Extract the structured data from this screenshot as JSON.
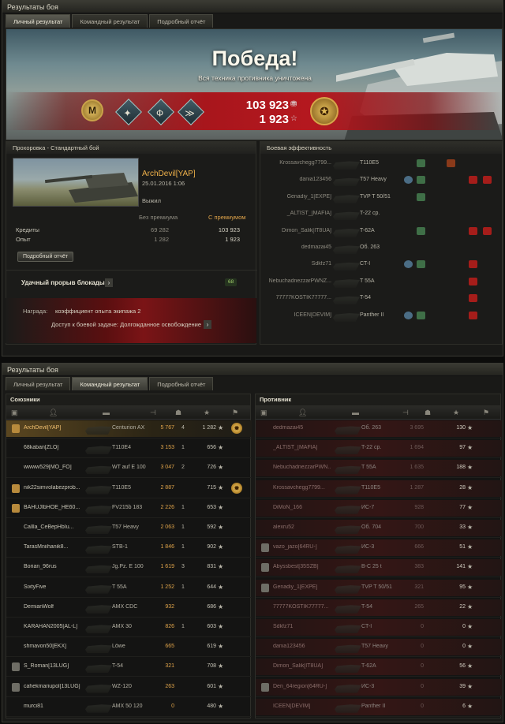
{
  "window1": {
    "title": "Результаты боя",
    "tabs": [
      "Личный результат",
      "Командный результат",
      "Подробный отчёт"
    ],
    "banner": {
      "headline": "Победа!",
      "subline": "Вся техника противника уничтожена",
      "credits": "103 923",
      "xp": "1 923",
      "medals": [
        "М",
        "",
        "",
        ""
      ]
    },
    "battle_panel": {
      "header": "Прохоровка - Стандартный бой",
      "player": "ArchDevil[YAP]",
      "date": "25.01.2016 1:06",
      "status": "Выжил",
      "col_no_premium": "Без премиума",
      "col_premium": "С премиумом",
      "rows": [
        {
          "label": "Кредиты",
          "base": "69 282",
          "prem": "103 923"
        },
        {
          "label": "Опыт",
          "base": "1 282",
          "prem": "1 923"
        }
      ],
      "report_button": "Подробный отчёт",
      "blockade_label": "Удачный прорыв блокады",
      "blockade_value": "68",
      "award_label": "Награда:",
      "award_value": "коэффициент опыта экипажа 2",
      "access_text": "Доступ к боевой задаче: Долгожданное освобождение"
    },
    "efficiency_panel": {
      "header": "Боевая эффективность",
      "rows": [
        {
          "name": "Krossavchegg7799...",
          "tank": "T110E5"
        },
        {
          "name": "dania123456",
          "tank": "T57 Heavy"
        },
        {
          "name": "Genadiy_1[EXPE]",
          "tank": "TVP T 50/51"
        },
        {
          "name": "_ALTIST_[MAFIA]",
          "tank": "T-22 ср."
        },
        {
          "name": "Dimon_Salik[IT8UA]",
          "tank": "T-62A"
        },
        {
          "name": "dedmazai45",
          "tank": "Об. 263"
        },
        {
          "name": "Sdkfz71",
          "tank": "CT-I"
        },
        {
          "name": "NebuchadnezzarPWNZ...",
          "tank": "T 55A"
        },
        {
          "name": "77777KOSTIK77777...",
          "tank": "T-54"
        },
        {
          "name": "ICEEN[DEVIM]",
          "tank": "Panther II"
        }
      ]
    }
  },
  "window2": {
    "title": "Результаты боя",
    "tabs": [
      "Личный результат",
      "Командный результат",
      "Подробный отчёт"
    ],
    "allies_header": "Союзники",
    "enemies_header": "Противник",
    "allies": [
      {
        "name": "ArchDevil[YAP]",
        "tank": "Centurion AX",
        "dmg": "5 767",
        "frags": "4",
        "xp": "1 282"
      },
      {
        "name": "68kaban[ZLO]",
        "tank": "T110E4",
        "dmg": "3 153",
        "frags": "1",
        "xp": "656"
      },
      {
        "name": "wwww529[MO_FO]",
        "tank": "WT auf E 100",
        "dmg": "3 047",
        "frags": "2",
        "xp": "726"
      },
      {
        "name": "nik22simvolabezprob...",
        "tank": "T110E5",
        "dmg": "2 887",
        "frags": "",
        "xp": "715"
      },
      {
        "name": "BAHUJIbHOE_HE60...",
        "tank": "FV215b 183",
        "dmg": "2 226",
        "frags": "1",
        "xp": "653"
      },
      {
        "name": "Callla_CeBepHbIu...",
        "tank": "T57 Heavy",
        "dmg": "2 063",
        "frags": "1",
        "xp": "592"
      },
      {
        "name": "TarasMniihanik8...",
        "tank": "STB-1",
        "dmg": "1 846",
        "frags": "1",
        "xp": "902"
      },
      {
        "name": "Borian_96rus",
        "tank": "Jg.Pz. E 100",
        "dmg": "1 619",
        "frags": "3",
        "xp": "831"
      },
      {
        "name": "SixtyFive",
        "tank": "T 55A",
        "dmg": "1 252",
        "frags": "1",
        "xp": "644"
      },
      {
        "name": "DemianWolf",
        "tank": "AMX CDC",
        "dmg": "932",
        "frags": "",
        "xp": "686"
      },
      {
        "name": "KARAHAN2005[AL-L]",
        "tank": "AMX 30",
        "dmg": "826",
        "frags": "1",
        "xp": "603"
      },
      {
        "name": "shmavon50[EKX]",
        "tank": "Löwe",
        "dmg": "665",
        "frags": "",
        "xp": "619"
      },
      {
        "name": "S_Roman[13LUG]",
        "tank": "T-54",
        "dmg": "321",
        "frags": "",
        "xp": "708"
      },
      {
        "name": "cahekmariupol[13LUG]",
        "tank": "WZ-120",
        "dmg": "263",
        "frags": "",
        "xp": "601"
      },
      {
        "name": "murci81",
        "tank": "AMX 50 120",
        "dmg": "0",
        "frags": "",
        "xp": "480"
      }
    ],
    "enemies": [
      {
        "name": "dedmazai45",
        "tank": "Об. 263",
        "dmg": "3 695",
        "frags": "",
        "xp": "130"
      },
      {
        "name": "_ALTIST_[MAFIA]",
        "tank": "T-22 ср.",
        "dmg": "1 694",
        "frags": "",
        "xp": "97"
      },
      {
        "name": "NebuchadnezzarPWN..",
        "tank": "T 55A",
        "dmg": "1 635",
        "frags": "",
        "xp": "188"
      },
      {
        "name": "Krossavchegg7799...",
        "tank": "T110E5",
        "dmg": "1 287",
        "frags": "",
        "xp": "28"
      },
      {
        "name": "DiMoN_166",
        "tank": "ИС-7",
        "dmg": "928",
        "frags": "",
        "xp": "77"
      },
      {
        "name": "alexru52",
        "tank": "Об. 704",
        "dmg": "700",
        "frags": "",
        "xp": "33"
      },
      {
        "name": "vazo_jazo[64RU-]",
        "tank": "ИС-3",
        "dmg": "666",
        "frags": "",
        "xp": "51"
      },
      {
        "name": "Abyssbest[35SZB]",
        "tank": "B-C 25 t",
        "dmg": "383",
        "frags": "",
        "xp": "141"
      },
      {
        "name": "Genadiy_1[EXPE]",
        "tank": "TVP T 50/51",
        "dmg": "321",
        "frags": "",
        "xp": "95"
      },
      {
        "name": "77777KOSTIK77777...",
        "tank": "T-54",
        "dmg": "265",
        "frags": "",
        "xp": "22"
      },
      {
        "name": "Sdkfz71",
        "tank": "CT-I",
        "dmg": "0",
        "frags": "",
        "xp": "0"
      },
      {
        "name": "dania123456",
        "tank": "T57 Heavy",
        "dmg": "0",
        "frags": "",
        "xp": "0"
      },
      {
        "name": "Dimon_Salik[IT8UA]",
        "tank": "T-62A",
        "dmg": "0",
        "frags": "",
        "xp": "56"
      },
      {
        "name": "Den_64region[64RU-]",
        "tank": "ИС-3",
        "dmg": "0",
        "frags": "",
        "xp": "39"
      },
      {
        "name": "ICEEN[DEVIM]",
        "tank": "Panther II",
        "dmg": "0",
        "frags": "",
        "xp": "6"
      }
    ]
  }
}
